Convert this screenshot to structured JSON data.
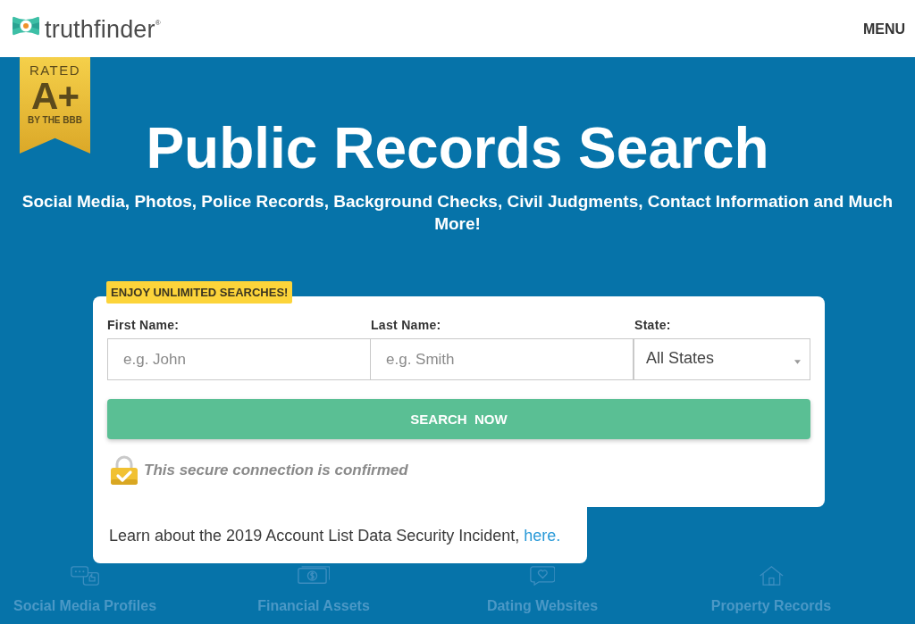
{
  "header": {
    "logo_text": "truthfinder$^{®}$",
    "menu": "MENU"
  },
  "badge": {
    "top": "RATED",
    "grade": "A+",
    "bottom": "BY THE BBB"
  },
  "hero": {
    "title": "Public Records Search",
    "subtitle": "Social Media, Photos, Police Records, Background Checks, Civil Judgments, Contact Information and Much More!"
  },
  "search_form": {
    "promo_tag": "ENJOY UNLIMITED SEARCHES!",
    "fields": [
      {
        "kind": "text",
        "label": "First Name:",
        "placeholder": "e.g. John"
      },
      {
        "kind": "text",
        "label": "Last Name:",
        "placeholder": "e.g. Smith"
      },
      {
        "kind": "select",
        "label": "State:",
        "value": "All States"
      }
    ],
    "submit": "SEARCH  NOW",
    "security_note": "This secure connection is confirmed",
    "incident_notice": {
      "text": "Learn about the 2019 Account List Data Security Incident,",
      "link": "here."
    }
  },
  "categories": [
    {
      "kind": "social",
      "label": "Social Media Profiles"
    },
    {
      "kind": "financial",
      "label": "Financial Assets"
    },
    {
      "kind": "dating",
      "label": "Dating Websites"
    },
    {
      "kind": "property",
      "label": "Property Records"
    }
  ]
}
